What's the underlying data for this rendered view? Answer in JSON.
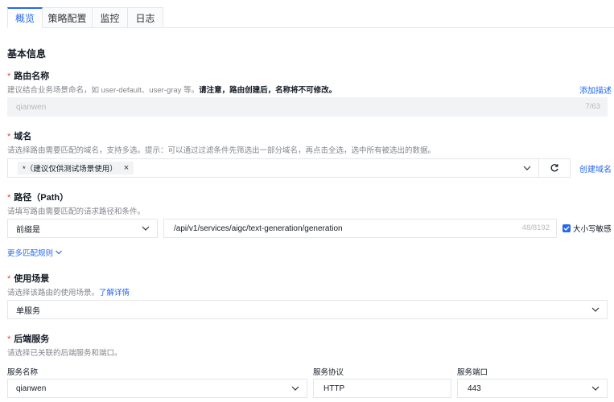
{
  "tabs": [
    {
      "label": "概览",
      "active": true
    },
    {
      "label": "策略配置",
      "active": false
    },
    {
      "label": "监控",
      "active": false
    },
    {
      "label": "日志",
      "active": false
    }
  ],
  "section_title": "基本信息",
  "route_name": {
    "required_mark": "*",
    "label": "路由名称",
    "help_plain": "建议结合业务场景命名，如 user-default、user-gray 等。",
    "help_bold": "请注意，路由创建后，名称将不可修改。",
    "add_desc_link": "添加描述",
    "value": "qianwen",
    "counter": "7/63"
  },
  "domain": {
    "required_mark": "*",
    "label": "域名",
    "help": "请选择路由需要匹配的域名，支持多选。提示：可以通过过滤条件先筛选出一部分域名，再点击全选，选中所有被选出的数据。",
    "tag": "*（建议仅供测试场景使用）",
    "tag_close": "×",
    "create_link": "创建域名"
  },
  "path": {
    "required_mark": "*",
    "label": "路径（Path）",
    "help": "请填写路由需要匹配的请求路径和条件。",
    "match_type": "前缀是",
    "value": "/api/v1/services/aigc/text-generation/generation",
    "counter": "48/8192",
    "case_sensitive_label": "大小写敏感",
    "case_sensitive_checked": true
  },
  "more_rules": "更多匹配规则",
  "scenario": {
    "required_mark": "*",
    "label": "使用场景",
    "help": "请选择该路由的使用场景。",
    "help_link": "了解详情",
    "value": "单服务"
  },
  "backend": {
    "required_mark": "*",
    "label": "后端服务",
    "help": "请选择已关联的后端服务和端口。",
    "service_name_label": "服务名称",
    "service_name_value": "qianwen",
    "protocol_label": "服务协议",
    "protocol_value": "HTTP",
    "port_label": "服务端口",
    "port_value": "443"
  },
  "colors": {
    "accent": "#2468f2",
    "required": "#f33e3e",
    "help_text": "#84868c",
    "border": "#e3e6ea"
  }
}
